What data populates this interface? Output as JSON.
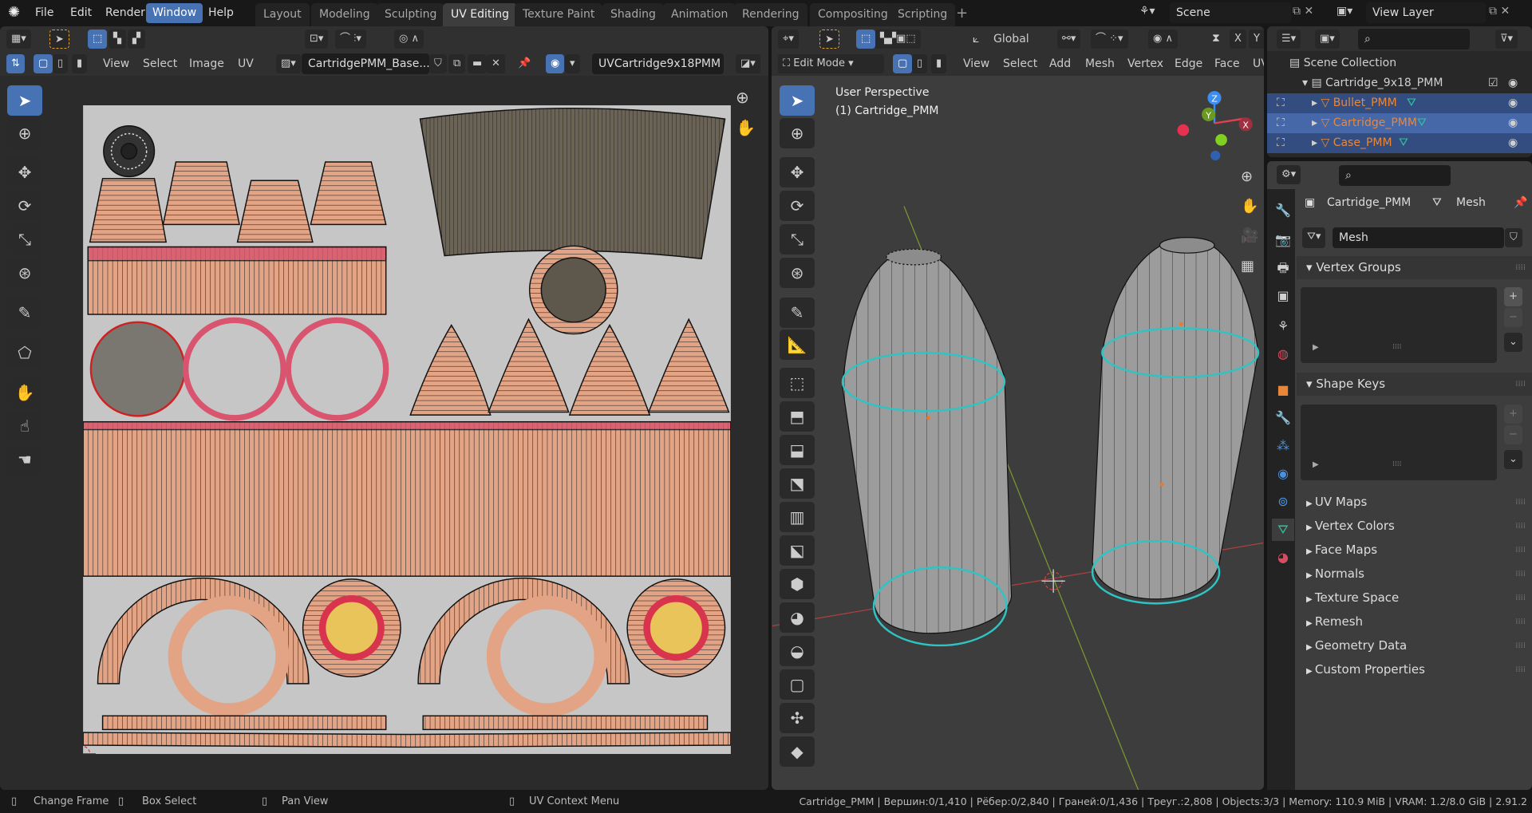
{
  "topbar": {
    "menus": [
      "File",
      "Edit",
      "Render",
      "Window",
      "Help"
    ],
    "active_menu": "Window",
    "workspaces": [
      "Layout",
      "Modeling",
      "Sculpting",
      "UV Editing",
      "Texture Paint",
      "Shading",
      "Animation",
      "Rendering",
      "Compositing",
      "Scripting"
    ],
    "active_workspace": "UV Editing",
    "add_tab": "+",
    "scene": "Scene",
    "view_layer": "View Layer"
  },
  "uv_editor": {
    "menus": [
      "View",
      "Select",
      "Image",
      "UV"
    ],
    "image_name": "CartridgePMM_Base...",
    "uv_map": "UVCartridge9x18PMM"
  },
  "viewport": {
    "mode": "Edit Mode",
    "orientation": "Global",
    "menus": [
      "View",
      "Select",
      "Add",
      "Mesh",
      "Vertex",
      "Edge",
      "Face",
      "UV"
    ],
    "overlay_title": "User Perspective",
    "overlay_object": "(1) Cartridge_PMM",
    "axis_x": "X",
    "axis_y": "Y",
    "gizmo": {
      "x": "X",
      "y": "Y",
      "z": "Z"
    }
  },
  "outliner": {
    "root": "Scene Collection",
    "collection": "Cartridge_9x18_PMM",
    "objects": [
      {
        "name": "Bullet_PMM"
      },
      {
        "name": "Cartridge_PMM"
      },
      {
        "name": "Case_PMM"
      }
    ]
  },
  "properties": {
    "object": "Cartridge_PMM",
    "data_type": "Mesh",
    "mesh_name": "Mesh",
    "panels_open": [
      "Vertex Groups",
      "Shape Keys"
    ],
    "panels_closed": [
      "UV Maps",
      "Vertex Colors",
      "Face Maps",
      "Normals",
      "Texture Space",
      "Remesh",
      "Geometry Data",
      "Custom Properties"
    ]
  },
  "status": {
    "hint1": "Change Frame",
    "hint2": "Box Select",
    "hint3": "Pan View",
    "hint4": "UV Context Menu",
    "stats": "Cartridge_PMM | Вершин:0/1,410 | Рёбер:0/2,840 | Граней:0/1,436 | Треуг.:2,808 | Objects:3/3 | Memory: 110.9 MiB | VRAM: 1.2/8.0 GiB | 2.91.2"
  },
  "colors": {
    "accent": "#4772b3",
    "selected_row": "#334d80",
    "object_name": "#e8873a",
    "uv_island": "#e0a088",
    "seam": "#e0406a"
  }
}
